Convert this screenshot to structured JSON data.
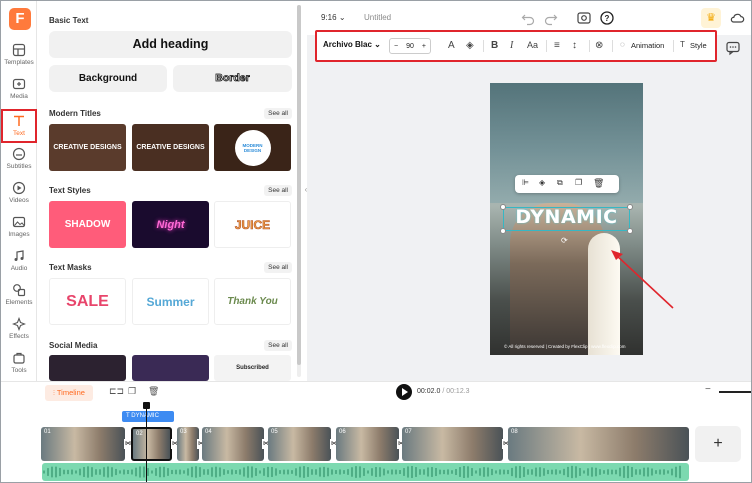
{
  "brand": {
    "logo_letter": "F",
    "accent": "#ff6a20"
  },
  "sidebar": {
    "items": [
      {
        "label": "Templates",
        "icon": "templates-icon"
      },
      {
        "label": "Media",
        "icon": "media-icon"
      },
      {
        "label": "Text",
        "icon": "text-icon",
        "active": true
      },
      {
        "label": "Subtitles",
        "icon": "subtitles-icon"
      },
      {
        "label": "Videos",
        "icon": "videos-icon"
      },
      {
        "label": "Images",
        "icon": "images-icon"
      },
      {
        "label": "Audio",
        "icon": "audio-icon"
      },
      {
        "label": "Elements",
        "icon": "elements-icon"
      },
      {
        "label": "Effects",
        "icon": "effects-icon"
      },
      {
        "label": "Tools",
        "icon": "tools-icon"
      }
    ]
  },
  "panel": {
    "basic_text": {
      "title": "Basic Text",
      "add_heading": "Add heading",
      "background": "Background",
      "border": "Border"
    },
    "see_all": "See all",
    "modern_titles": {
      "title": "Modern Titles",
      "items": [
        "CREATIVE DESIGNS",
        "CREATIVE DESIGNS",
        "MODERN DESIGN"
      ]
    },
    "text_styles": {
      "title": "Text Styles",
      "items": [
        "SHADOW",
        "Night",
        "JUICE"
      ]
    },
    "text_masks": {
      "title": "Text Masks",
      "items": [
        "SALE",
        "Summer",
        "Thank You"
      ]
    },
    "social_media": {
      "title": "Social Media",
      "items": [
        "",
        "",
        "Subscribed"
      ]
    }
  },
  "topbar": {
    "ratio": "9:16",
    "title": "Untitled"
  },
  "toolbar": {
    "font": "Archivo Blac",
    "size": "90",
    "minus": "−",
    "plus": "+",
    "case": "Aa",
    "animation": "Animation",
    "style": "Style"
  },
  "canvas": {
    "text": "DYNAMIC",
    "credit": "© All rights reserved | Created by FlexClip | www.flexclip.com"
  },
  "timeline": {
    "label": "Timeline",
    "current": "00:02.0",
    "total": "/ 00:12.3",
    "text_clip": "DYNAMIC",
    "clips": [
      "01",
      "02",
      "03",
      "04",
      "05",
      "06",
      "07",
      "08"
    ],
    "add": "+"
  }
}
